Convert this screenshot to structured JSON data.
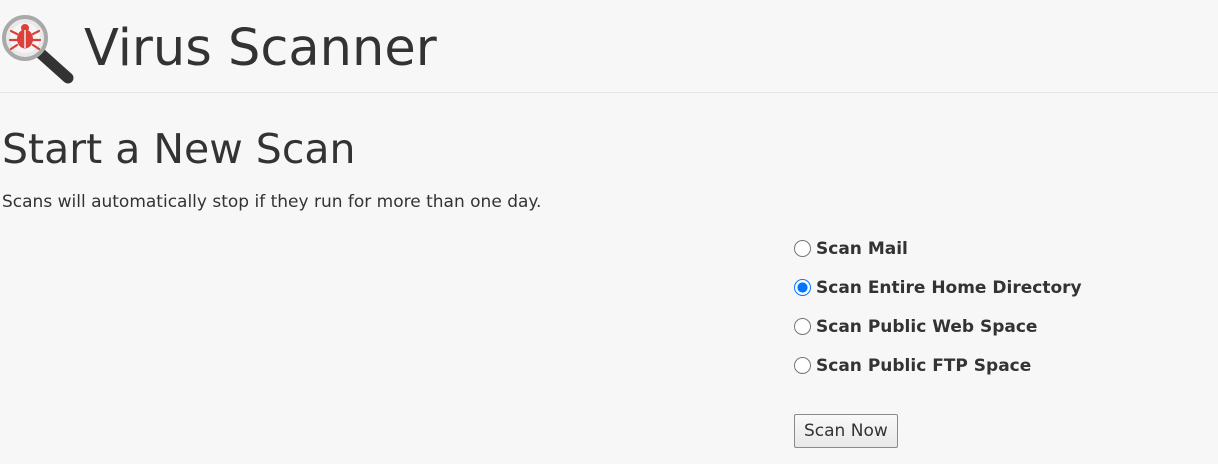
{
  "header": {
    "title": "Virus Scanner",
    "icon": "virus-scanner-magnifier-bug-icon"
  },
  "section": {
    "title": "Start a New Scan",
    "description": "Scans will automatically stop if they run for more than one day."
  },
  "scan_options": [
    {
      "label": "Scan Mail",
      "selected": false
    },
    {
      "label": "Scan Entire Home Directory",
      "selected": true
    },
    {
      "label": "Scan Public Web Space",
      "selected": false
    },
    {
      "label": "Scan Public FTP Space",
      "selected": false
    }
  ],
  "actions": {
    "scan_now_label": "Scan Now"
  },
  "colors": {
    "background": "#f7f7f7",
    "text": "#333333",
    "icon_bug": "#d9413a",
    "icon_handle": "#333333",
    "divider": "#e6e6e6"
  }
}
